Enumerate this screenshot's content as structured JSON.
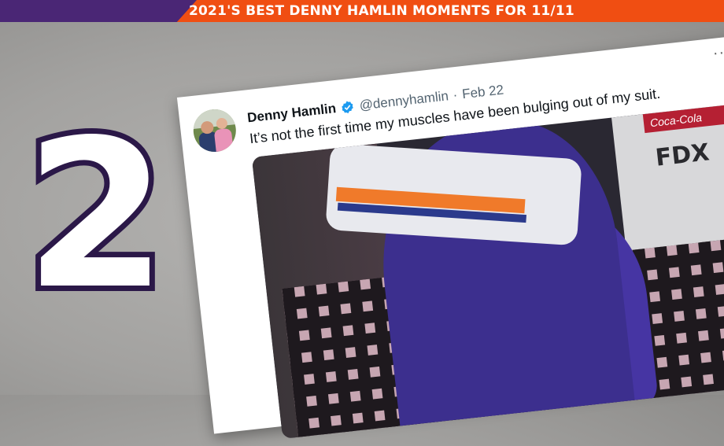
{
  "header": {
    "title": "2021'S BEST DENNY HAMLIN MOMENTS FOR 11/11",
    "bar_color": "#f04e12",
    "accent_color": "#4a2675"
  },
  "rank": {
    "number": "2"
  },
  "tweet": {
    "display_name": "Denny Hamlin",
    "handle": "@dennyhamlin",
    "separator": "·",
    "date": "Feb 22",
    "text": "It’s not the first time my muscles have been bulging out of my suit.",
    "more_label": "···",
    "verified_icon": "verified-badge-icon",
    "media": {
      "brand_text": "FDX",
      "sponsor_text": "Coca-Cola"
    }
  }
}
